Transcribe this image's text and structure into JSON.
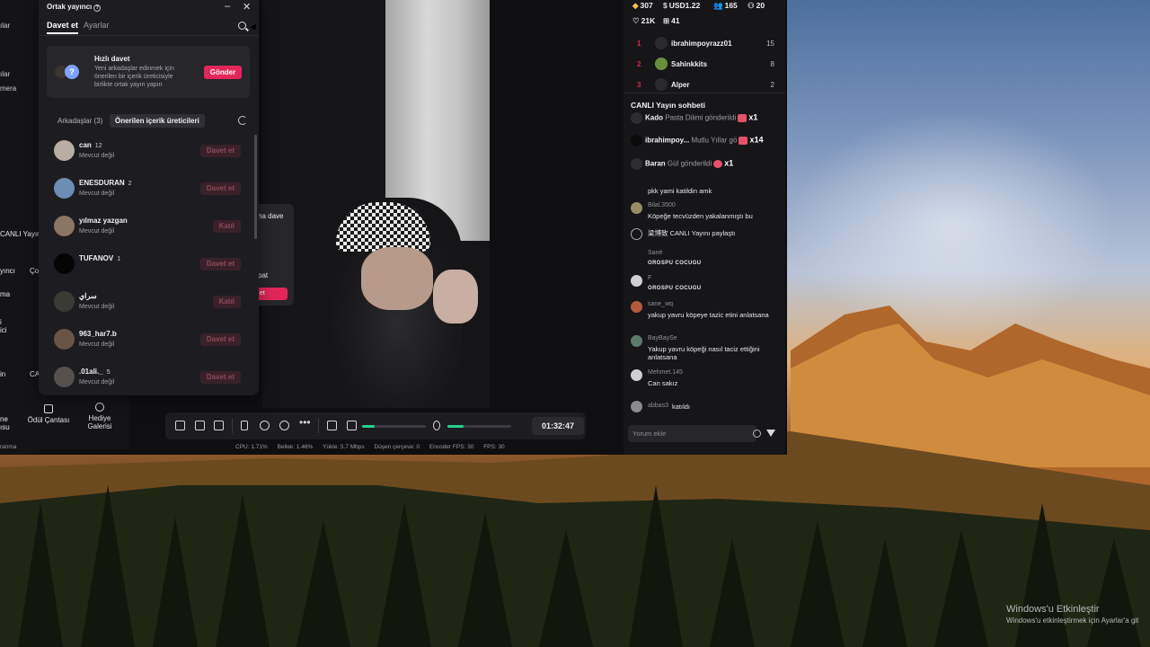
{
  "desktop": {
    "activation_title": "Windows'u Etkinleştir",
    "activation_desc": "Windows'u etkinleştirmek için Ayarlar'a git"
  },
  "left_rail": {
    "items": [
      "ılar",
      "mera",
      "CANLI Yayın",
      "yıncı",
      "Ço",
      "ma",
      "i ici",
      "in",
      "CA",
      "ne ısu"
    ]
  },
  "sidebar_tiles": {
    "reward_bag": "Ödül Çantası",
    "gift_gallery": "Hediye Galerisi",
    "bottom_label": "ranma"
  },
  "popup": {
    "title": "Ortak yayıncı",
    "tabs": [
      "Davet et",
      "Ayarlar"
    ],
    "quick_invite": {
      "title": "Hızlı davet",
      "desc": "Yeni arkadaşlar edinmek için önerilen bir içerik üreticisiyle birlikte ortak yayın yapın",
      "button": "Gönder"
    },
    "subtabs": [
      "Arkadaşlar (3)",
      "Önerilen içerik üreticileri"
    ],
    "users": [
      {
        "name": "can",
        "count": "12",
        "status": "Mevcut değil",
        "button": "Davet et"
      },
      {
        "name": "ENESDURAN",
        "count": "2",
        "status": "Mevcut değil",
        "button": "Davet et"
      },
      {
        "name": "yılmaz yazgan",
        "count": "",
        "status": "Mevcut değil",
        "button": "Katıl"
      },
      {
        "name": "TUFANOV",
        "count": "1",
        "status": "",
        "button": "Davet et"
      },
      {
        "name": "سراي",
        "count": "",
        "status": "Mevcut değil",
        "button": "Katıl"
      },
      {
        "name": "963_har7.b",
        "count": "",
        "status": "Mevcut değil",
        "button": "Davet et"
      },
      {
        "name": ".01ali._",
        "count": "5",
        "status": "Mevcut değil",
        "button": "Davet et"
      }
    ]
  },
  "video_overlay": {
    "line1": "na dave",
    "line2": "pat",
    "button": "et"
  },
  "toolbar": {
    "timer": "01:32:47",
    "volume_level": 0.2,
    "mic_level": 0.25
  },
  "stats": {
    "cpu": "CPU: 1.71%",
    "memory": "Bellek: 1.46%",
    "upload": "Yükle: 5.7 Mbps",
    "dropped": "Düşen çerçeve: 0",
    "encoder_fps": "Encoder FPS: 30",
    "fps": "FPS: 30"
  },
  "right_panel": {
    "kpis": {
      "diamonds": "307",
      "usd": "USD1.22",
      "viewers": "165",
      "likes_small": "20",
      "likes": "21K",
      "gifts": "41"
    },
    "ranking": [
      {
        "rank": "1",
        "name": "ibrahimpoyrazz01",
        "score": "15"
      },
      {
        "rank": "2",
        "name": "Sahinkkits",
        "score": "8"
      },
      {
        "rank": "3",
        "name": "Alper",
        "score": "2"
      }
    ],
    "chat_title": "CANLI Yayın sohbeti",
    "gifts": [
      {
        "user": "Kado",
        "text": "Pasta Dilimi gönderildi",
        "mult": "x1"
      },
      {
        "user": "ibrahimpoy...",
        "text": "Mutlu Yıllar gö",
        "mult": "x14"
      },
      {
        "user": "Baran",
        "text": "Gül gönderildi",
        "mult": "x1"
      }
    ],
    "messages": [
      {
        "user": "",
        "text": "pkk yami katildin amk"
      },
      {
        "user": "Bilal.3500",
        "text": "Köpeğe tecvüzden yakalanmıştı bu"
      },
      {
        "user": "",
        "text": "梁博致  CANLI Yayını paylaştı"
      },
      {
        "user": "Sané",
        "text": "OROSPU COCUGU"
      },
      {
        "user": "F",
        "text": "OROSPU COCUGU"
      },
      {
        "user": "sane_wq",
        "text": "yakup yavru köpeye tazic etini anlatsana"
      },
      {
        "user": "BayBaySe",
        "text": "Yakup yavru köpeği nasıl taciz ettiğini anlatsana"
      },
      {
        "user": "Mehmet.145",
        "text": "Can sakız"
      },
      {
        "user": "abbas3",
        "text": "katıldı"
      }
    ],
    "comment_placeholder": "Yorum ekle"
  }
}
